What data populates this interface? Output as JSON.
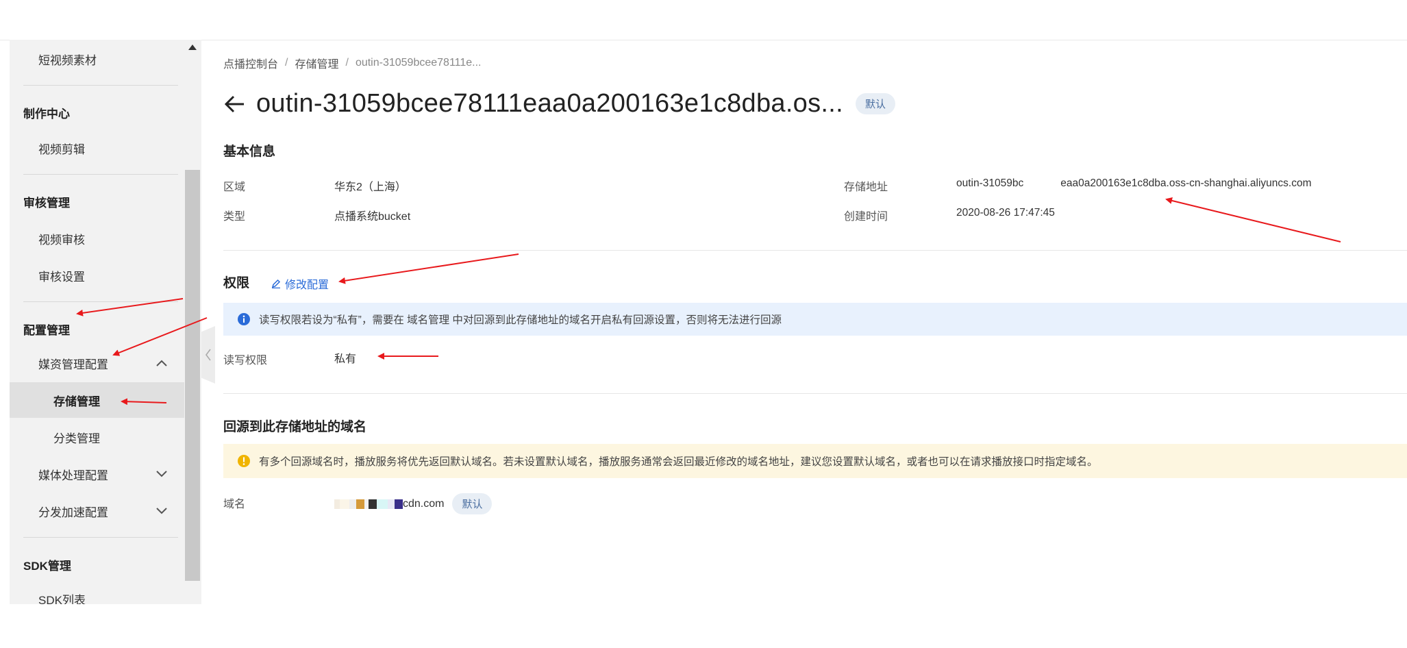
{
  "sidebar": {
    "items": [
      {
        "label": "短视频素材"
      },
      {
        "group": "制作中心"
      },
      {
        "label": "视频剪辑"
      },
      {
        "group": "审核管理"
      },
      {
        "label": "视频审核"
      },
      {
        "label": "审核设置"
      },
      {
        "group": "配置管理"
      },
      {
        "label": "媒资管理配置"
      },
      {
        "label": "存储管理"
      },
      {
        "label": "分类管理"
      },
      {
        "label": "媒体处理配置"
      },
      {
        "label": "分发加速配置"
      },
      {
        "group": "SDK管理"
      },
      {
        "label": "SDK列表"
      }
    ]
  },
  "breadcrumb": {
    "items": [
      "点播控制台",
      "存储管理",
      "outin-31059bcee78111e..."
    ],
    "separator": "/"
  },
  "page": {
    "title": "outin-31059bcee78111eaa0a200163e1c8dba.os...",
    "badge": "默认"
  },
  "basic_info": {
    "title": "基本信息",
    "region_label": "区域",
    "region_value": "华东2（上海）",
    "type_label": "类型",
    "type_value": "点播系统bucket",
    "storage_label": "存储地址",
    "storage_value_prefix": "outin-31059bc",
    "storage_value_suffix": "eaa0a200163e1c8dba.oss-cn-shanghai.aliyuncs.com",
    "created_label": "创建时间",
    "created_value": "2020-08-26 17:47:45"
  },
  "permission": {
    "title": "权限",
    "edit_link": "修改配置",
    "info_text": "读写权限若设为“私有”，需要在 域名管理 中对回源到此存储地址的域名开启私有回源设置，否则将无法进行回源",
    "rw_label": "读写权限",
    "rw_value": "私有"
  },
  "origin_domains": {
    "title": "回源到此存储地址的域名",
    "warn_text": "有多个回源域名时，播放服务将优先返回默认域名。若未设置默认域名，播放服务通常会返回最近修改的域名地址，建议您设置默认域名，或者也可以在请求播放接口时指定域名。",
    "domain_label": "域名",
    "domain_value_suffix": "cdn.com",
    "domain_badge": "默认"
  },
  "colors": {
    "accent": "#2a6bd8",
    "annotation_arrow": "#e8191c",
    "info_bg": "#e8f1fd",
    "warn_bg": "#fdf6e0",
    "warn_icon": "#f0b400"
  },
  "icons": [
    "back-arrow-icon",
    "edit-icon",
    "info-icon",
    "warning-icon",
    "chevron-up-icon",
    "chevron-down-icon",
    "scroll-up-icon",
    "collapse-left-icon"
  ]
}
